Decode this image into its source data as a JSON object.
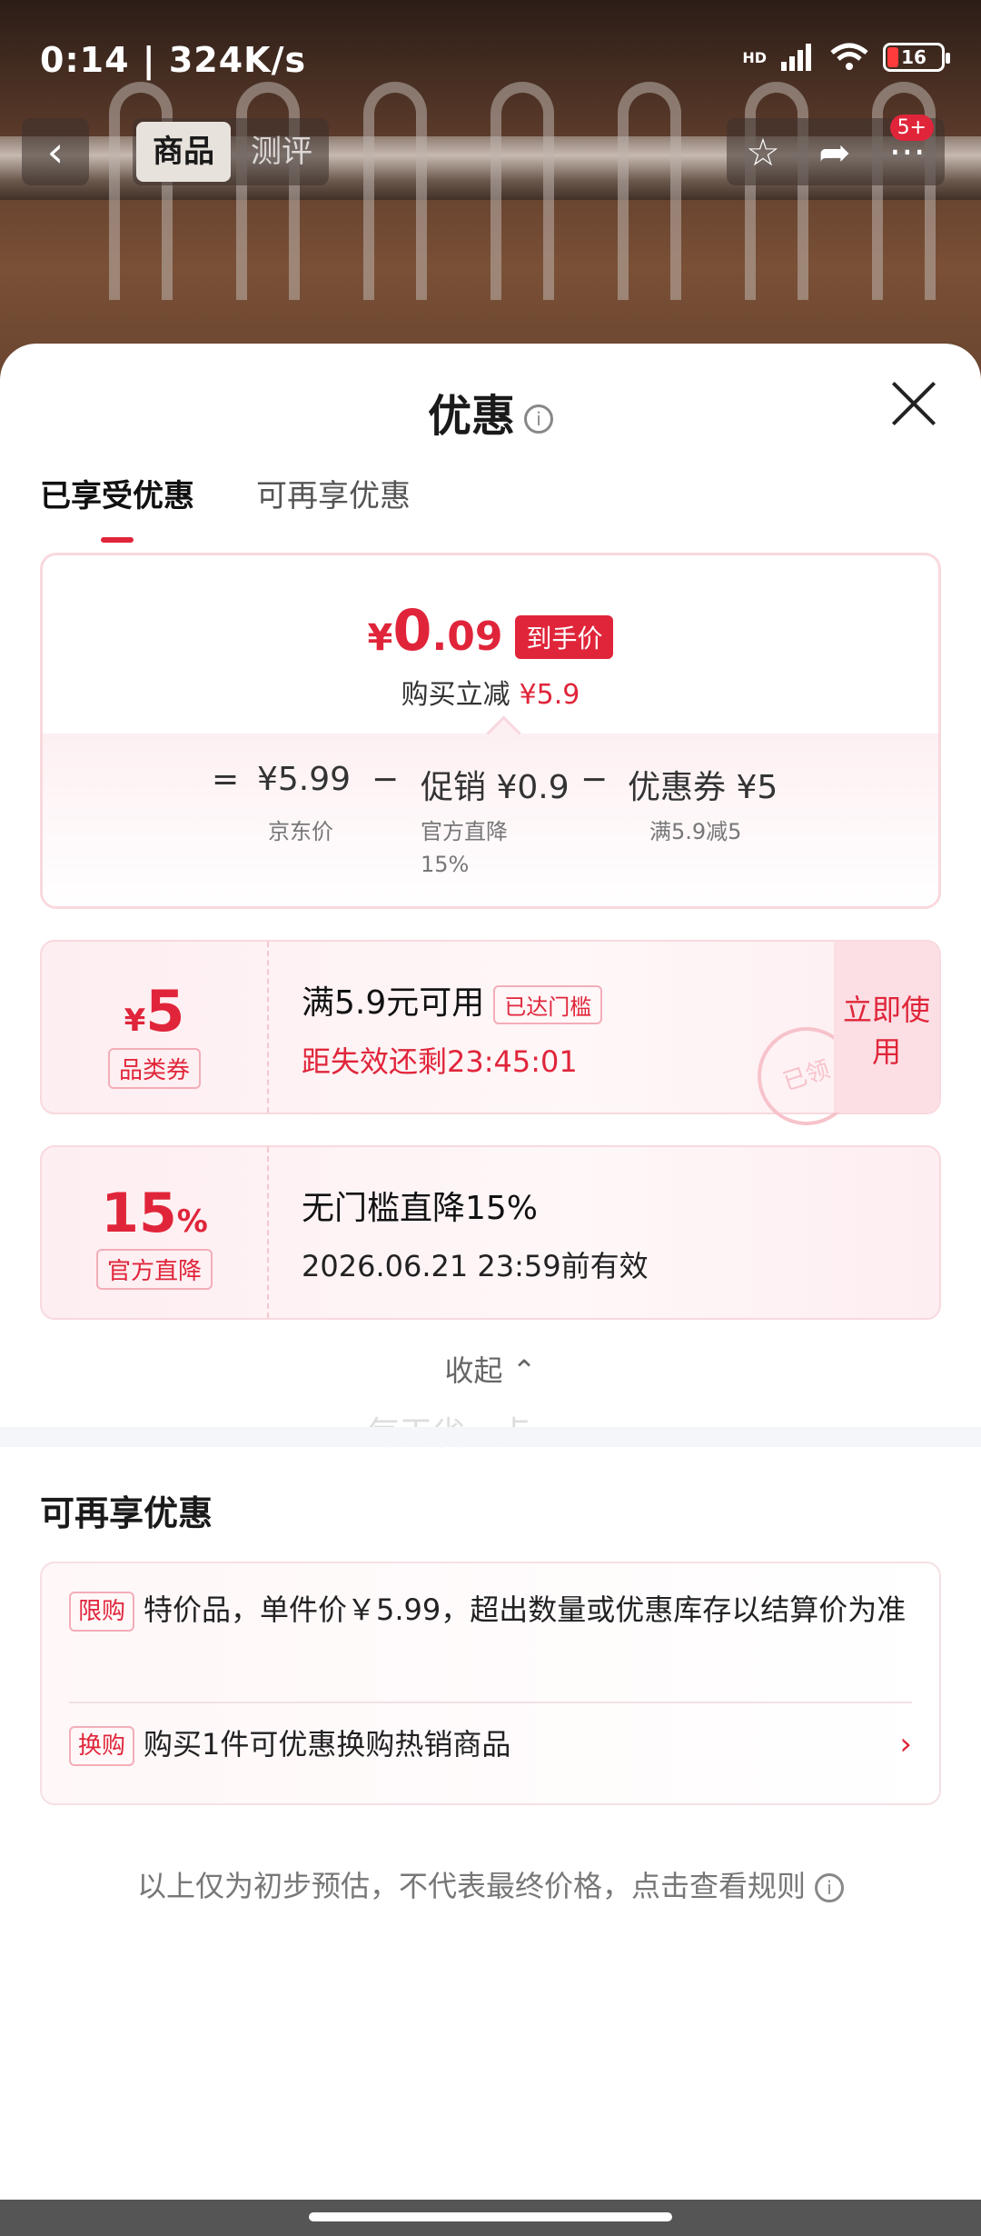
{
  "status_bar": {
    "time": "0:14 | 324K/s",
    "network": "HD",
    "battery": "16"
  },
  "nav": {
    "tab_product": "商品",
    "tab_review": "测评",
    "badge": "5+"
  },
  "sheet": {
    "title": "优惠",
    "tabs": [
      "已享受优惠",
      "可再享优惠"
    ],
    "price_card": {
      "yen": "¥",
      "int": "0",
      "dec": ".09",
      "tag": "到手价",
      "sub_label": "购买立减",
      "sub_value": "¥5.9",
      "eq": "=",
      "jd_price": "¥5.99",
      "jd_label": "京东价",
      "minus1": "−",
      "promo": "促销 ¥0.9",
      "promo_label": "官方直降",
      "promo_pct": "15%",
      "minus2": "−",
      "coupon": "优惠券 ¥5",
      "coupon_label": "满5.9减5"
    },
    "coupon1": {
      "yen": "¥",
      "amount": "5",
      "label": "品类券",
      "title": "满5.9元可用",
      "status": "已达门槛",
      "countdown": "距失效还剩23:45:01",
      "action": "立即使用",
      "stamp": "已领"
    },
    "coupon2": {
      "amount": "15",
      "unit": "%",
      "label": "官方直降",
      "title": "无门槛直降15%",
      "validity": "2026.06.21 23:59前有效"
    },
    "watermark": "每天省一点",
    "collapse": "收起 ⌃",
    "section_title": "可再享优惠",
    "extra": [
      {
        "tag": "限购",
        "text": "特价品，单件价￥5.99，超出数量或优惠库存以结算价为准"
      },
      {
        "tag": "换购",
        "text": "购买1件可优惠换购热销商品"
      }
    ],
    "footnote": "以上仅为初步预估，不代表最终价格，点击查看规则"
  },
  "colors": {
    "accent": "#e0253a",
    "pink_bg": "#fdeef1"
  }
}
